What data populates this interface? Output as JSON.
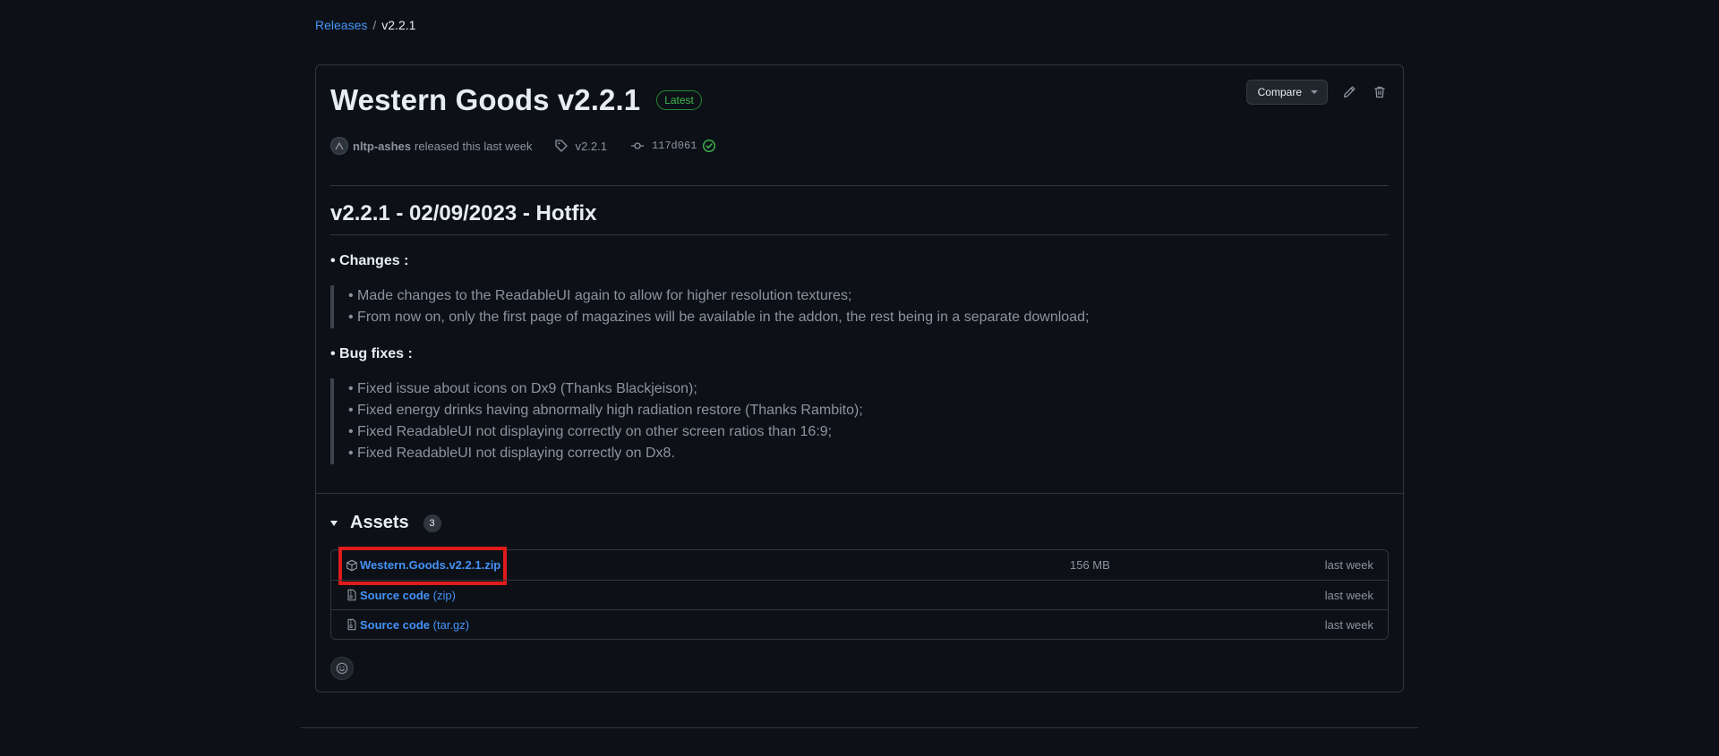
{
  "breadcrumb": {
    "releases_label": "Releases",
    "separator": "/",
    "current": "v2.2.1"
  },
  "release": {
    "title": "Western Goods v2.2.1",
    "badge": "Latest",
    "compare_label": "Compare",
    "author": "nltp-ashes",
    "released_text": "released this last week",
    "tag": "v2.2.1",
    "commit": "117d061"
  },
  "body": {
    "heading": "v2.2.1 - 02/09/2023 - Hotfix",
    "changes_label": "• Changes :",
    "changes": [
      "Made changes to the ReadableUI again to allow for higher resolution textures;",
      "From now on, only the first page of magazines will be available in the addon, the rest being in a separate download;"
    ],
    "bugfixes_label": "• Bug fixes :",
    "bugfixes": [
      "Fixed issue about icons on Dx9 (Thanks Blackjeison);",
      "Fixed energy drinks having abnormally high radiation restore (Thanks Rambito);",
      "Fixed ReadableUI not displaying correctly on other screen ratios than 16:9;",
      "Fixed ReadableUI not displaying correctly on Dx8."
    ]
  },
  "assets": {
    "title": "Assets",
    "count": "3",
    "items": [
      {
        "name": "Western.Goods.v2.2.1.zip",
        "suffix": "",
        "size": "156 MB",
        "date": "last week",
        "icon": "package-icon"
      },
      {
        "name": "Source code",
        "suffix": " (zip)",
        "size": "",
        "date": "last week",
        "icon": "file-zip-icon"
      },
      {
        "name": "Source code",
        "suffix": " (tar.gz)",
        "size": "",
        "date": "last week",
        "icon": "file-zip-icon"
      }
    ]
  },
  "colors": {
    "background": "#0d1117",
    "link": "#4493f8",
    "badge_green": "#3fb950",
    "highlight": "#e01b1b"
  }
}
